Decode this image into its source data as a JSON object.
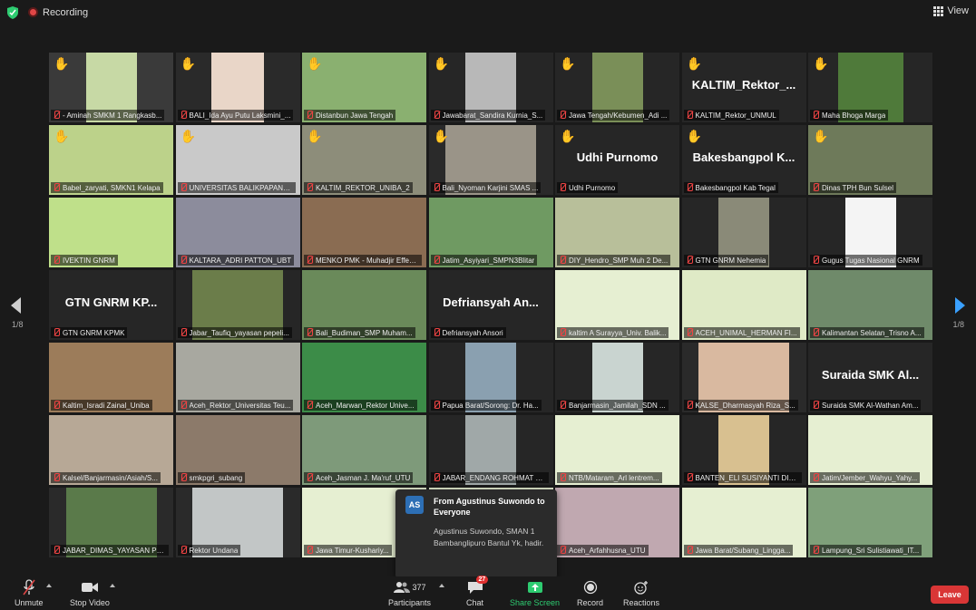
{
  "top_bar": {
    "recording_label": "Recording",
    "view_label": "View"
  },
  "pager": {
    "left": "1/8",
    "right": "1/8"
  },
  "tiles": [
    {
      "name": "- Aminah SMKM 1 Rangkasb...",
      "hand": true,
      "bg": "#3a3a3a",
      "video": "#c7d9a5",
      "vw": 56
    },
    {
      "name": "BALI_Ida Ayu Putu Laksmini_...",
      "hand": true,
      "bg": "#2a2a2a",
      "video": "#e9d6c8",
      "vw": 58
    },
    {
      "name": "Distanbun Jawa Tengah",
      "hand": true,
      "bg": "#2a2a2a",
      "video": "#8ab070",
      "vw": 137
    },
    {
      "name": "Jawabarat_Sandira Kurnia_S...",
      "hand": true,
      "bg": "#262626",
      "video": "#b8b8b8",
      "vw": 56
    },
    {
      "name": "Jawa Tengah/Kebumen_Adi ...",
      "hand": true,
      "bg": "#262626",
      "video": "#7a8f58",
      "vw": 56
    },
    {
      "name": "KALTIM_Rektor_UNMUL",
      "hand": true,
      "bg": "#262626",
      "text": "KALTIM_Rektor_..."
    },
    {
      "name": "Maha Bhoga Marga",
      "hand": true,
      "bg": "#262626",
      "video": "#4f7a3a",
      "vw": 72
    },
    {
      "name": "Babel_zaryati, SMKN1 Kelapa",
      "hand": true,
      "bg": "#2a2a2a",
      "video": "#bcd28a",
      "vw": 137
    },
    {
      "name": "UNIVERSITAS BALIKPAPAN_...",
      "hand": true,
      "bg": "#2a2a2a",
      "video": "#c9c9c9",
      "vw": 137
    },
    {
      "name": "KALTIM_REKTOR_UNIBA_2",
      "hand": true,
      "bg": "#2a2a2a",
      "video": "#8d8d7a",
      "vw": 137
    },
    {
      "name": "Bali_Nyoman Karjini SMAS ...",
      "hand": true,
      "bg": "#2a2a2a",
      "video": "#9a9488",
      "vw": 100
    },
    {
      "name": "Udhi Purnomo",
      "hand": true,
      "bg": "#262626",
      "text": "Udhi Purnomo"
    },
    {
      "name": "Bakesbangpol Kab Tegal",
      "hand": true,
      "bg": "#262626",
      "text": "Bakesbangpol  K..."
    },
    {
      "name": "Dinas TPH Bun Sulsel",
      "hand": true,
      "bg": "#2a2a2a",
      "video": "#6e7a5a",
      "vw": 137
    },
    {
      "name": "IVEKTIN GNRM",
      "hand": false,
      "bg": "#a9cf78",
      "video": "#bfe08a",
      "vw": 137,
      "active": true
    },
    {
      "name": "KALTARA_ADRI PATTON_UBT",
      "hand": false,
      "bg": "#2a2a2a",
      "video": "#8c8c9c",
      "vw": 137
    },
    {
      "name": "MENKO PMK - Muhadjir Effendy",
      "hand": false,
      "bg": "#2a2a2a",
      "video": "#8a6c52",
      "vw": 137
    },
    {
      "name": "Jatim_Asyiyari_SMPN3Blitar",
      "hand": false,
      "bg": "#2a2a2a",
      "video": "#6f9a62",
      "vw": 137
    },
    {
      "name": "DIY_Hendro_SMP Muh 2 De...",
      "hand": false,
      "bg": "#2a2a2a",
      "video": "#b8bf9a",
      "vw": 137
    },
    {
      "name": "GTN GNRM Nehemia",
      "hand": false,
      "bg": "#262626",
      "video": "#8a8a78",
      "vw": 56
    },
    {
      "name": "Gugus Tugas Nasional GNRM",
      "hand": false,
      "bg": "#262626",
      "video": "#f4f4f4",
      "vw": 56
    },
    {
      "name": "GTN GNRM KPMK",
      "hand": false,
      "bg": "#262626",
      "text": "GTN GNRM KP..."
    },
    {
      "name": "Jabar_Taufiq_yayasan pepeli...",
      "hand": false,
      "bg": "#262626",
      "video": "#6b7d4a",
      "vw": 100
    },
    {
      "name": "Bali_Budiman_SMP Muham...",
      "hand": false,
      "bg": "#2a2a2a",
      "video": "#6a8a5a",
      "vw": 137
    },
    {
      "name": "Defriansyah Ansori",
      "hand": false,
      "bg": "#262626",
      "text": "Defriansyah  An..."
    },
    {
      "name": "kaltim A Surayya_Univ. Balik...",
      "hand": false,
      "bg": "#2a2a2a",
      "video": "#e6efd2",
      "vw": 137
    },
    {
      "name": "ACEH_UNIMAL_HERMAN FI...",
      "hand": false,
      "bg": "#2a2a2a",
      "video": "#dfeac6",
      "vw": 137
    },
    {
      "name": "Kalimantan Selatan_Trisno A...",
      "hand": false,
      "bg": "#2a2a2a",
      "video": "#6f8a6a",
      "vw": 137
    },
    {
      "name": "Kaltim_Isradi Zainal_Uniba",
      "hand": false,
      "bg": "#2a2a2a",
      "video": "#9c7c5a",
      "vw": 137
    },
    {
      "name": "Aceh_Rektor_Universitas Teu...",
      "hand": false,
      "bg": "#2a2a2a",
      "video": "#a8a8a0",
      "vw": 137
    },
    {
      "name": "Aceh_Marwan_Rektor Unive...",
      "hand": false,
      "bg": "#2a2a2a",
      "video": "#3c8c48",
      "vw": 137
    },
    {
      "name": "Papua Barat/Sorong: Dr. Ha...",
      "hand": false,
      "bg": "#262626",
      "video": "#8aa0b0",
      "vw": 56
    },
    {
      "name": "Banjarmasin_Jamilah_SDN ...",
      "hand": false,
      "bg": "#262626",
      "video": "#c9d4d0",
      "vw": 56
    },
    {
      "name": "KALSE_Dharmasyah Riza_S...",
      "hand": false,
      "bg": "#2a2a2a",
      "video": "#d9b9a0",
      "vw": 100
    },
    {
      "name": "Suraida SMK Al-Wathan Am...",
      "hand": false,
      "bg": "#262626",
      "text": "Suraida  SMK  Al..."
    },
    {
      "name": "Kalsel/Banjarmasin/Asiah/S...",
      "hand": false,
      "bg": "#2a2a2a",
      "video": "#b7a896",
      "vw": 137
    },
    {
      "name": "smkpgri_subang",
      "hand": false,
      "bg": "#2a2a2a",
      "video": "#8c7a6a",
      "vw": 137
    },
    {
      "name": "Aceh_Jasman J. Ma'ruf_UTU",
      "hand": false,
      "bg": "#2a2a2a",
      "video": "#7e9a7a",
      "vw": 137
    },
    {
      "name": "JABAR_ENDANG ROHMAT S...",
      "hand": false,
      "bg": "#262626",
      "video": "#a0a8a8",
      "vw": 56
    },
    {
      "name": "NTB/Mataram_Arl lentrem...",
      "hand": false,
      "bg": "#2a2a2a",
      "video": "#e6efd2",
      "vw": 137
    },
    {
      "name": "BANTEN_ELI SUSIYANTI DIN...",
      "hand": false,
      "bg": "#262626",
      "video": "#d8c090",
      "vw": 56
    },
    {
      "name": "Jatim/Jember_Wahyu_Yahy...",
      "hand": false,
      "bg": "#2a2a2a",
      "video": "#e6efd2",
      "vw": 137
    },
    {
      "name": "JABAR_DIMAS_YAYASAN PE...",
      "hand": false,
      "bg": "#2a2a2a",
      "video": "#5a7a4a",
      "vw": 100
    },
    {
      "name": "Rektor Undana",
      "hand": false,
      "bg": "#2a2a2a",
      "video": "#c2c6c6",
      "vw": 100
    },
    {
      "name": "Jawa Timur-Kushariy...",
      "hand": false,
      "bg": "#2a2a2a",
      "video": "#e6efd2",
      "vw": 137
    },
    {
      "name": "",
      "hand": false,
      "bg": "#262626",
      "video": "#e6efd2",
      "vw": 137
    },
    {
      "name": "Aceh_Arfahhusna_UTU",
      "hand": false,
      "bg": "#2a2a2a",
      "video": "#c0a8b0",
      "vw": 137
    },
    {
      "name": "Jawa Barat/Subang_Lingga...",
      "hand": false,
      "bg": "#2a2a2a",
      "video": "#e6efd2",
      "vw": 137
    },
    {
      "name": "Lampung_Sri Sulistiawati_IT...",
      "hand": false,
      "bg": "#2a2a2a",
      "video": "#7fa07a",
      "vw": 137
    }
  ],
  "chat_popup": {
    "avatar": "AS",
    "from": "From Agustinus Suwondo to Everyone",
    "message": "Agustinus Suwondo, SMAN 1 Bambanglipuro Bantul Yk, hadir."
  },
  "toolbar": {
    "unmute": "Unmute",
    "stop_video": "Stop Video",
    "participants": "Participants",
    "participants_count": "377",
    "chat": "Chat",
    "chat_badge": "27",
    "share_screen": "Share Screen",
    "record": "Record",
    "reactions": "Reactions",
    "leave": "Leave"
  },
  "colors": {
    "accent_green": "#2ecc71",
    "leave_red": "#d93636",
    "active_outline": "#d6e75a",
    "nav_blue": "#3aa0ff"
  }
}
